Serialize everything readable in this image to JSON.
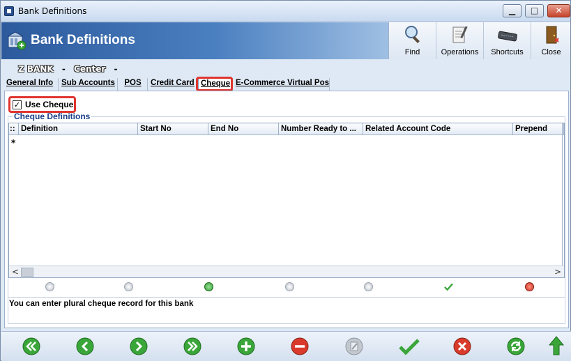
{
  "window": {
    "title": "Bank Definitions"
  },
  "banner": {
    "title": "Bank Definitions"
  },
  "toolbar": {
    "find_label": "Find",
    "operations_label": "Operations",
    "shortcuts_label": "Shortcuts",
    "close_label": "Close"
  },
  "info": {
    "bank": "Z BANK",
    "sep1": "-",
    "branch": "Center",
    "sep2": "-"
  },
  "tabs": [
    {
      "label": "General Info"
    },
    {
      "label": "Sub Accounts"
    },
    {
      "label": "POS"
    },
    {
      "label": "Credit Card"
    },
    {
      "label": "Cheque"
    },
    {
      "label": "E-Commerce Virtual Pos"
    }
  ],
  "use_cheque": {
    "label": "Use Cheque",
    "checked": true,
    "check_glyph": "✓"
  },
  "cheque_definitions": {
    "title": "Cheque Definitions",
    "columns": [
      {
        "label": "::"
      },
      {
        "label": "Definition"
      },
      {
        "label": "Start No"
      },
      {
        "label": "End No"
      },
      {
        "label": "Number Ready to ..."
      },
      {
        "label": "Related Account Code"
      },
      {
        "label": "Prepend"
      }
    ],
    "new_row_indicator": "*",
    "scroll_left": "<",
    "scroll_right": ">"
  },
  "grid_nav_icons": [
    "first-icon",
    "previous-icon",
    "add-icon",
    "remove-icon",
    "edit-icon",
    "confirm-icon",
    "cancel-icon"
  ],
  "note": "You can enter plural cheque record for this bank",
  "bottom_icons": [
    "first-record-icon",
    "previous-record-icon",
    "next-record-icon",
    "last-record-icon",
    "add-record-icon",
    "delete-record-icon",
    "edit-record-icon",
    "save-icon",
    "cancel-icon",
    "refresh-icon",
    "up-arrow-icon"
  ],
  "colors": {
    "highlight": "#e03530",
    "banner": "#2c5a9c",
    "green": "#3aa63a",
    "red": "#d93a2b"
  }
}
